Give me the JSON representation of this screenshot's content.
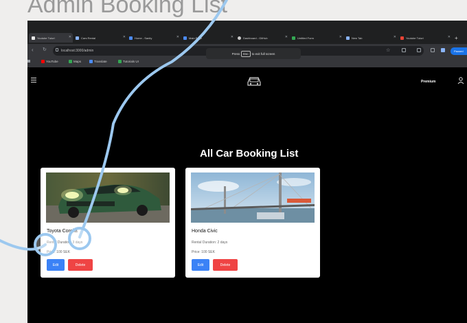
{
  "slide": {
    "title": "Admin Booking List"
  },
  "browser": {
    "tabs": [
      {
        "label": "Youtube Tutori",
        "favicon_color": "#e8e8e8",
        "active": true
      },
      {
        "label": "Cars Rental",
        "favicon_color": "#8ab4f8",
        "active": false
      },
      {
        "label": "Home - Sanity",
        "favicon_color": "#4c8bf5",
        "active": false
      },
      {
        "label": "Main Page",
        "favicon_color": "#4c8bf5",
        "active": false
      },
      {
        "label": "Dashboard - GitHub",
        "favicon_color": "#cccccc",
        "active": false
      },
      {
        "label": "Untitled Form",
        "favicon_color": "#34a853",
        "active": false
      },
      {
        "label": "New Tab",
        "favicon_color": "#8ab4f8",
        "active": false
      },
      {
        "label": "Youtube Tutori",
        "favicon_color": "#ea4335",
        "active": false
      }
    ],
    "url": "localhost:3000/admin",
    "profile_button": "Paused",
    "toast": {
      "prefix": "Press",
      "key": "Esc",
      "suffix": "to exit full screen"
    },
    "bookmarks": [
      {
        "label": "YouTube",
        "icon_color": "#ff0000"
      },
      {
        "label": "Maps",
        "icon_color": "#34a853"
      },
      {
        "label": "Translate",
        "icon_color": "#4c8bf5"
      },
      {
        "label": "Tutorials UI",
        "icon_color": "#34a853"
      }
    ]
  },
  "navbar": {
    "right_label": "Premium"
  },
  "main": {
    "title": "All Car Booking List"
  },
  "cards": [
    {
      "name": "Toyota Corolla",
      "duration": "Rental Duration: 3 days",
      "price": "Price: 100 SEK",
      "edit_label": "Edit",
      "delete_label": "Delete"
    },
    {
      "name": "Honda Civic",
      "duration": "Rental Duration: 2 days",
      "price": "Price: 100 SEK",
      "edit_label": "Edit",
      "delete_label": "Delete"
    }
  ],
  "colors": {
    "accent": "#3b82f6",
    "danger": "#ef4444",
    "annotation": "#9cc8ef"
  }
}
